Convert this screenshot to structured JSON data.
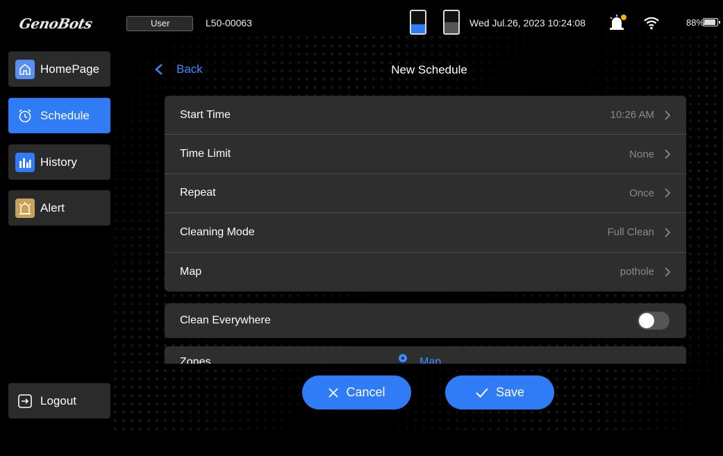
{
  "app": {
    "brand": "GenoBots"
  },
  "statusbar": {
    "user_label": "User",
    "robot_id": "L50-00063",
    "datetime": "Wed Jul.26, 2023 10:24:08",
    "battery_pct": "88%",
    "battery_level": 0.88,
    "tank_left_level": 0.4,
    "tank_right_level": 0.5,
    "tank_left_color": "#2f7cf6",
    "tank_right_color": "#555555",
    "alert_badge_color": "#f5b400"
  },
  "sidebar": {
    "items": [
      {
        "label": "HomePage",
        "icon": "home-icon",
        "active": false,
        "color": "#5a8ff2"
      },
      {
        "label": "Schedule",
        "icon": "alarm-clock-icon",
        "active": true,
        "color": "#2f7cf6"
      },
      {
        "label": "History",
        "icon": "bar-chart-icon",
        "active": false,
        "color": "#2f7cf6"
      },
      {
        "label": "Alert",
        "icon": "alarm-light-icon",
        "active": false,
        "color": "#c9a15a"
      }
    ],
    "logout_label": "Logout"
  },
  "header": {
    "back_label": "Back",
    "title": "New Schedule"
  },
  "settings": [
    {
      "label": "Start Time",
      "value": "10:26 AM"
    },
    {
      "label": "Time Limit",
      "value": "None"
    },
    {
      "label": "Repeat",
      "value": "Once"
    },
    {
      "label": "Cleaning Mode",
      "value": "Full Clean"
    },
    {
      "label": "Map",
      "value": "pothole"
    }
  ],
  "clean_everywhere": {
    "label": "Clean Everywhere",
    "enabled": false
  },
  "zones": {
    "label": "Zones",
    "option": "Map"
  },
  "actions": {
    "cancel_label": "Cancel",
    "save_label": "Save"
  },
  "colors": {
    "accent": "#2f7cf6",
    "link": "#3d8bff",
    "card": "#2e2e2e"
  }
}
